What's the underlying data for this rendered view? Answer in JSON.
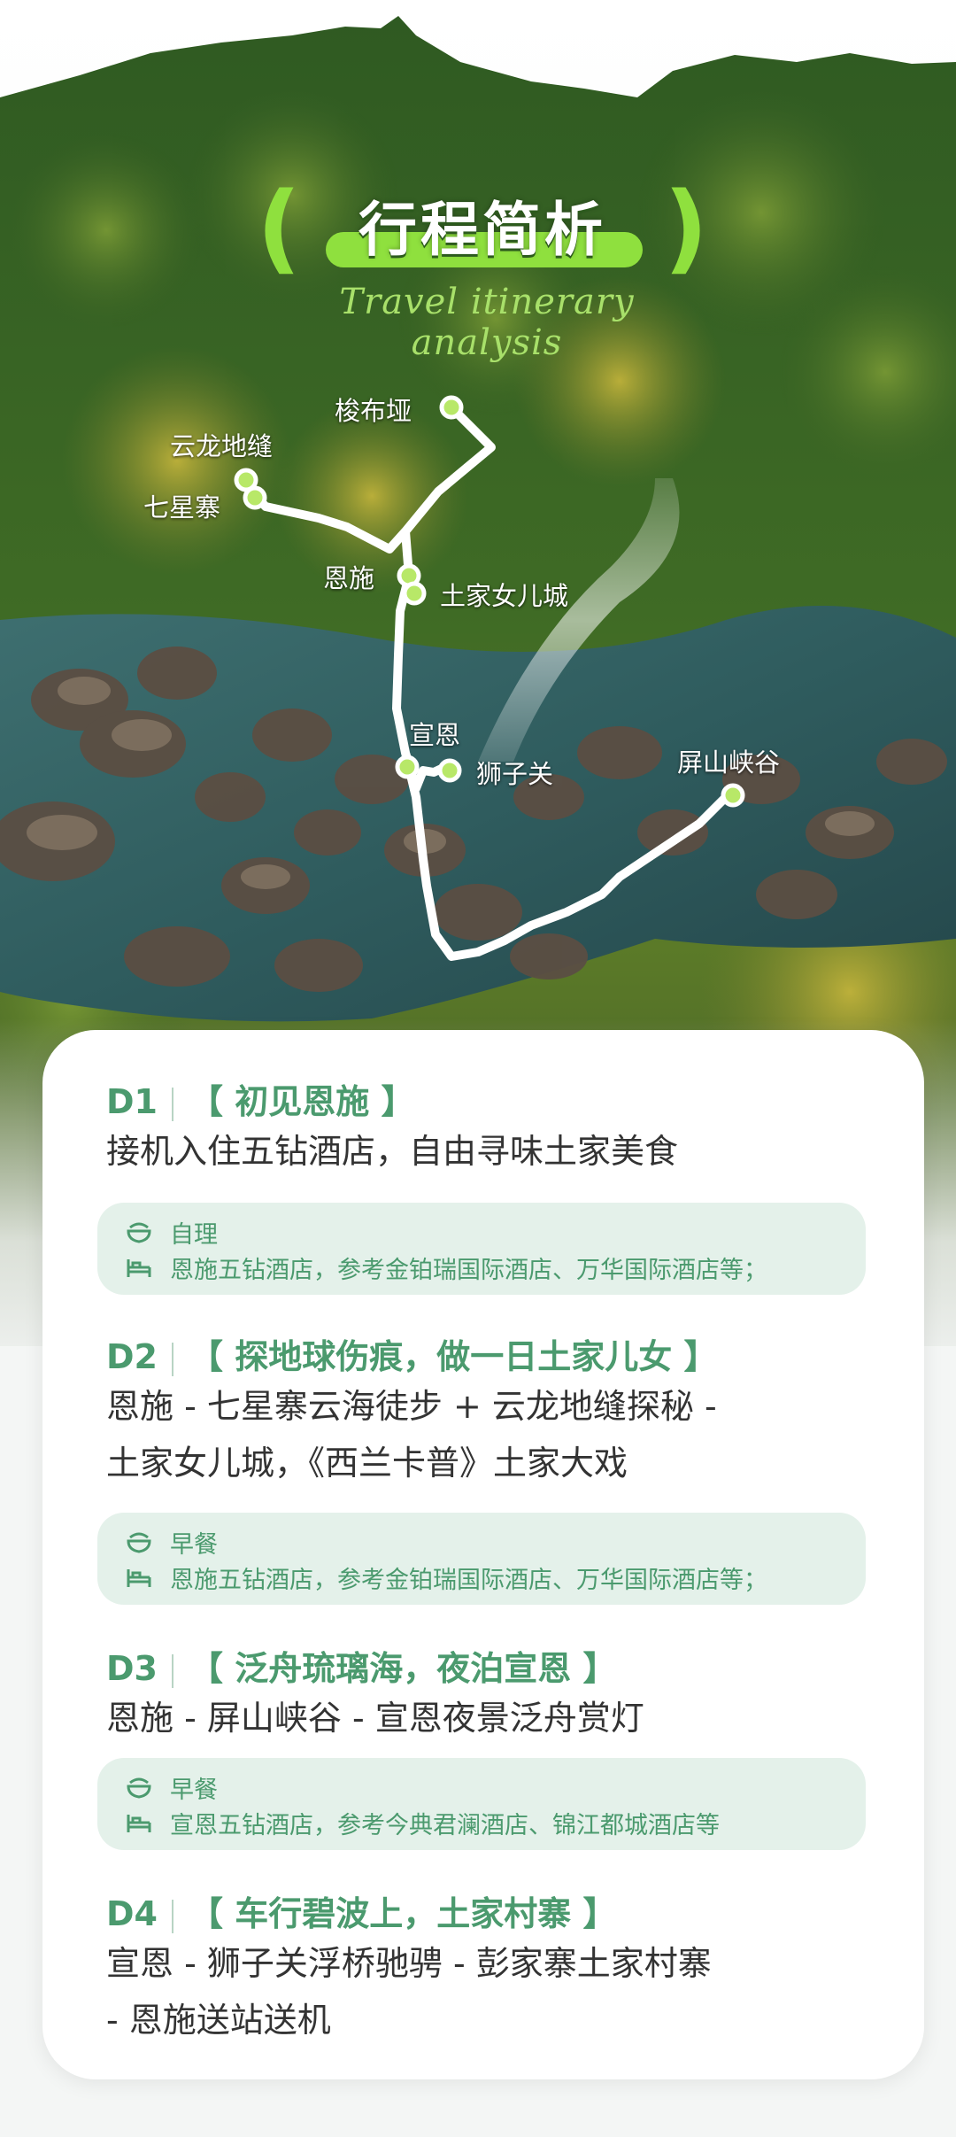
{
  "header": {
    "title": "行程简析",
    "subtitle": "Travel itinerary analysis"
  },
  "map": {
    "places": {
      "suobuya": "梭布垭",
      "yunlong": "云龙地缝",
      "qixingzhai": "七星寨",
      "enshi": "恩施",
      "tujia": "土家女儿城",
      "xuanen": "宣恩",
      "shiziguan": "狮子关",
      "pingshan": "屏山峡谷"
    }
  },
  "days": [
    {
      "num": "D1",
      "title": "【 初见恩施 】",
      "lines": [
        "接机入住五钻酒店，自由寻味土家美食"
      ],
      "meal": "自理",
      "hotel": "恩施五钻酒店，参考金铂瑞国际酒店、万华国际酒店等；"
    },
    {
      "num": "D2",
      "title": "【 探地球伤痕，做一日土家儿女 】",
      "lines": [
        "恩施 - 七星寨云海徒步 + 云龙地缝探秘 -",
        "土家女儿城，《西兰卡普》土家大戏"
      ],
      "meal": "早餐",
      "hotel": "恩施五钻酒店，参考金铂瑞国际酒店、万华国际酒店等；"
    },
    {
      "num": "D3",
      "title": "【 泛舟琉璃海，夜泊宣恩 】",
      "lines": [
        "恩施 - 屏山峡谷 - 宣恩夜景泛舟赏灯"
      ],
      "meal": "早餐",
      "hotel": "宣恩五钻酒店，参考今典君澜酒店、锦江都城酒店等"
    },
    {
      "num": "D4",
      "title": "【 车行碧波上，土家村寨 】",
      "lines": [
        "宣恩 - 狮子关浮桥驰骋 -  彭家寨土家村寨",
        "- 恩施送站送机"
      ]
    }
  ],
  "colors": {
    "accent_green": "#4b9a6e",
    "title_green": "#8fe03e",
    "info_bg": "#e4f1ea"
  }
}
